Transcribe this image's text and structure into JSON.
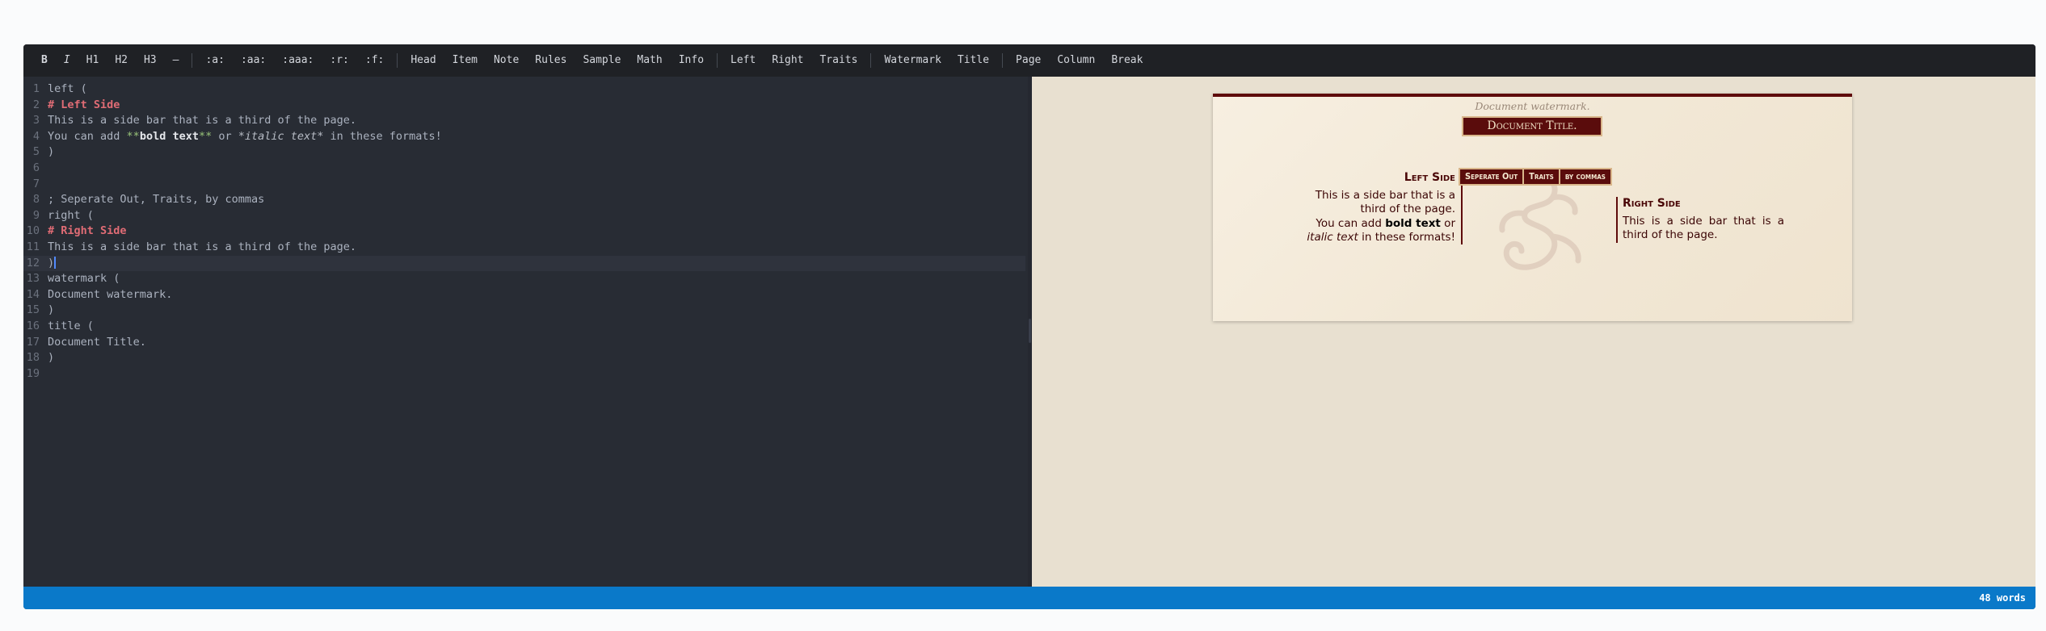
{
  "toolbar": {
    "group_format": [
      "B",
      "I",
      "H1",
      "H2",
      "H3",
      "—"
    ],
    "group_spacing": [
      ":a:",
      ":aa:",
      ":aaa:",
      ":r:",
      ":f:"
    ],
    "group_blocks": [
      "Head",
      "Item",
      "Note",
      "Rules",
      "Sample",
      "Math",
      "Info"
    ],
    "group_layout": [
      "Left",
      "Right",
      "Traits"
    ],
    "group_meta": [
      "Watermark",
      "Title"
    ],
    "group_page": [
      "Page",
      "Column",
      "Break"
    ]
  },
  "editor": {
    "line_numbers": [
      "1",
      "2",
      "3",
      "4",
      "5",
      "6",
      "7",
      "8",
      "9",
      "10",
      "11",
      "12",
      "13",
      "14",
      "15",
      "16",
      "17",
      "18",
      "19"
    ],
    "lines": [
      "left (",
      "# Left Side",
      "This is a side bar that is a third of the page.",
      "You can add **bold text** or *italic text* in these formats!",
      ")",
      "",
      "",
      "; Seperate Out, Traits, by commas",
      "right (",
      "# Right Side",
      "This is a side bar that is a third of the page.",
      ")",
      "watermark (",
      "Document watermark.",
      ")",
      "title (",
      "Document Title.",
      ")",
      ""
    ],
    "line4_parts": {
      "a": "You can add ",
      "b_open": "**",
      "b_text": "bold text",
      "b_close": "**",
      "mid": " or ",
      "i_text": "*italic text*",
      "tail": " in these formats!"
    }
  },
  "preview": {
    "watermark": "Document watermark.",
    "title": "Document Title.",
    "left": {
      "heading": "Left Side",
      "text": "This is a side bar that is a third of the page.",
      "t2a": "You can add ",
      "t2b": "bold text",
      "t2c": " or",
      "t3a": "italic text",
      "t3b": " in these formats!"
    },
    "traits": [
      "Seperate Out",
      "Traits",
      "by commas"
    ],
    "right": {
      "heading": "Right Side",
      "text": "This is a side bar that is a third of the page."
    }
  },
  "status": {
    "word_count": "48 words"
  },
  "colors": {
    "accent": "#5a0c0c",
    "status_bar": "#0a79c9",
    "editor_bg": "#282c34"
  }
}
